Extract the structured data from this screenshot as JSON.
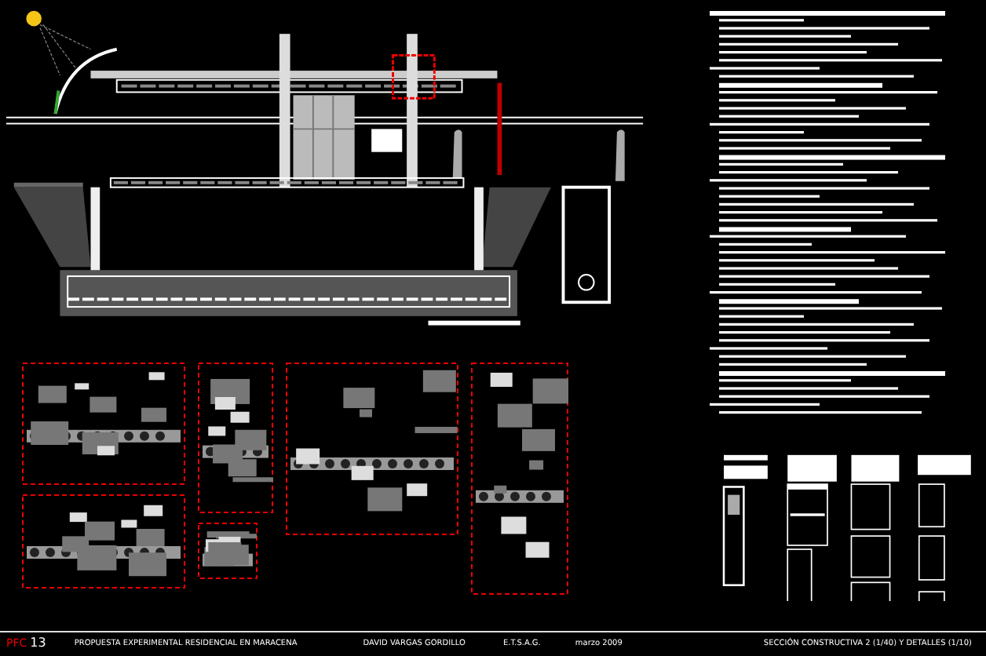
{
  "title_block": {
    "sheet_code": "PFC",
    "sheet_number": "13",
    "project": "PROPUESTA EXPERIMENTAL RESIDENCIAL EN MARACENA",
    "author": "DAVID VARGAS GORDILLO",
    "school": "E.T.S.A.G.",
    "date": "marzo 2009",
    "sheet_title": "SECCIÓN CONSTRUCTIVA 2 (1/40) Y DETALLES (1/10)"
  }
}
